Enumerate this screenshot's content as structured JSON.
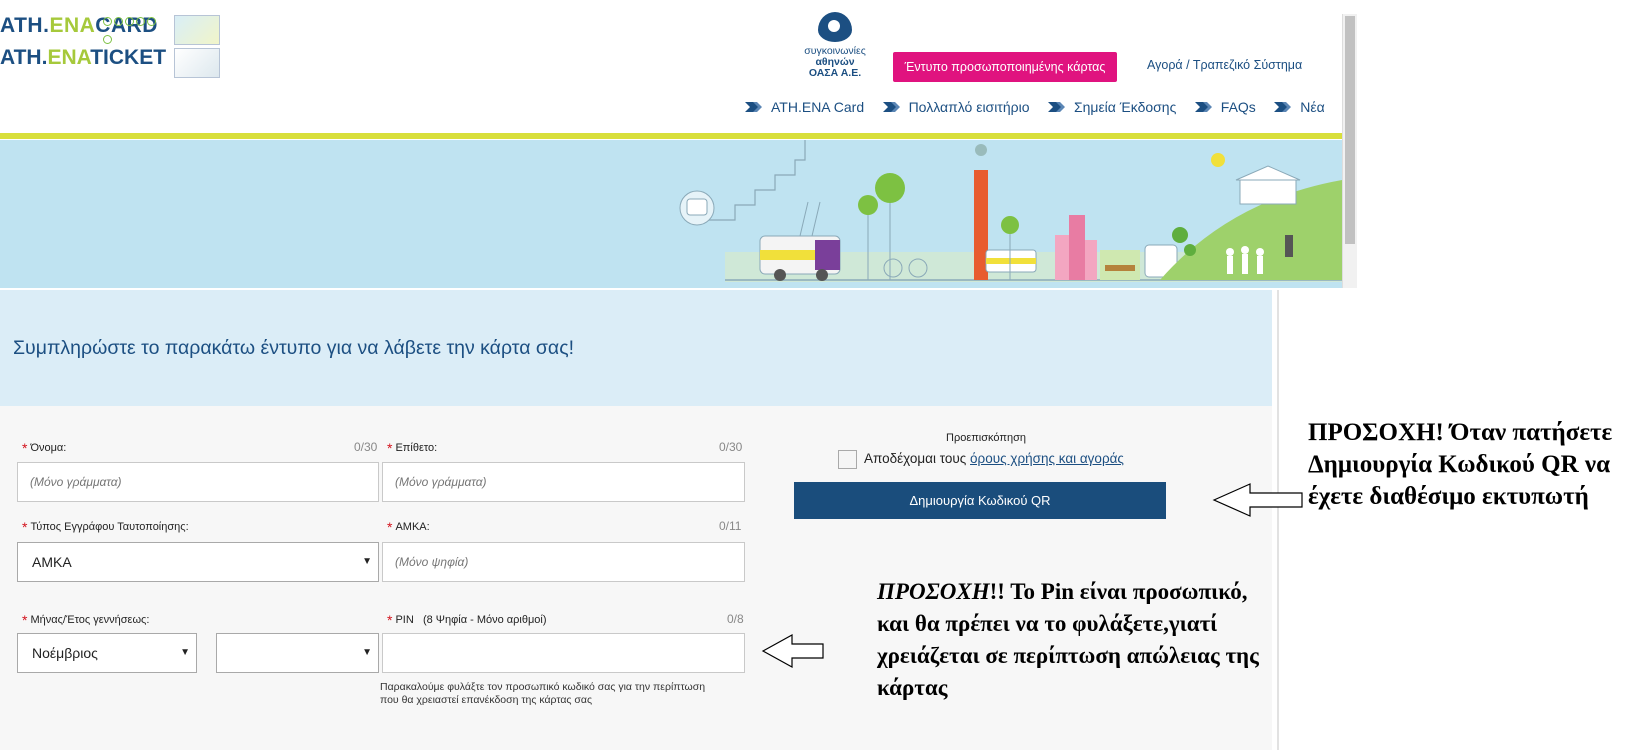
{
  "header": {
    "logo_card_prefix": "ATH.",
    "logo_card_accent": "ENA",
    "logo_card_suffix": "CARD",
    "logo_ticket_prefix": "ATH.",
    "logo_ticket_accent": "ENA",
    "logo_ticket_suffix": "TICKET",
    "oasa_line1": "συγκοινωνίες",
    "oasa_line2": "αθηνών",
    "oasa_line3": "ΟΑΣΑ Α.Ε.",
    "personal_card_button": "Έντυπο προσωποποιημένης κάρτας",
    "purchase_link": "Αγορά / Τραπεζικό Σύστημα",
    "nav": [
      {
        "label": "ATH.ENA Card"
      },
      {
        "label": "Πολλαπλό εισιτήριο"
      },
      {
        "label": "Σημεία Έκδοσης"
      },
      {
        "label": "FAQs"
      },
      {
        "label": "Νέα"
      }
    ]
  },
  "banner": {
    "title": "Συμπληρώστε το παρακάτω έντυπο για να λάβετε την κάρτα σας!"
  },
  "form": {
    "first_name": {
      "label": "Όνομα:",
      "counter": "0/30",
      "placeholder": "(Μόνο γράμματα)"
    },
    "last_name": {
      "label": "Επίθετο:",
      "counter": "0/30",
      "placeholder": "(Μόνο γράμματα)"
    },
    "id_type": {
      "label": "Τύπος Εγγράφου Ταυτοποίησης:",
      "value": "ΑΜΚΑ"
    },
    "amka": {
      "label": "ΑΜΚΑ:",
      "counter": "0/11",
      "placeholder": "(Μόνο ψηφία)"
    },
    "birth": {
      "label": "Μήνας/Έτος γεννήσεως:",
      "month_value": "Νοέμβριος",
      "year_value": ""
    },
    "pin": {
      "label": "PIN",
      "hint": "(8 Ψηφία - Μόνο αριθμοί)",
      "counter": "0/8",
      "placeholder": ""
    },
    "pin_help": "Παρακαλούμε φυλάξτε τον προσωπικό κωδικό σας για την περίπτωση που θα χρειαστεί επανέκδοση της κάρτας σας",
    "required_mark": "*"
  },
  "preview": {
    "label": "Προεπισκόπηση",
    "terms_prefix": "Αποδέχομαι τους ",
    "terms_link": "όρους χρήσης και αγοράς",
    "qr_button": "Δημιουργία Κωδικού QR"
  },
  "annotations": {
    "printer_note": "ΠΡΟΣΟΧΗ! Όταν πατήσετε Δημιουργία Κωδικού QR να έχετε διαθέσιμο εκτυπωτή",
    "pin_note_italic": "ΠΡΟΣΟΧΗ",
    "pin_note_rest": "!! Το Pin είναι προσωπικό, και θα πρέπει να το φυλάξετε,γιατί χρειάζεται σε περίπτωση απώλειας της κάρτας"
  },
  "colors": {
    "brand_blue": "#1c4f82",
    "magenta": "#e0137f",
    "yellow_bar": "#d8df3b",
    "hero_sky": "#bfe3f1",
    "required_red": "#d3121c"
  }
}
